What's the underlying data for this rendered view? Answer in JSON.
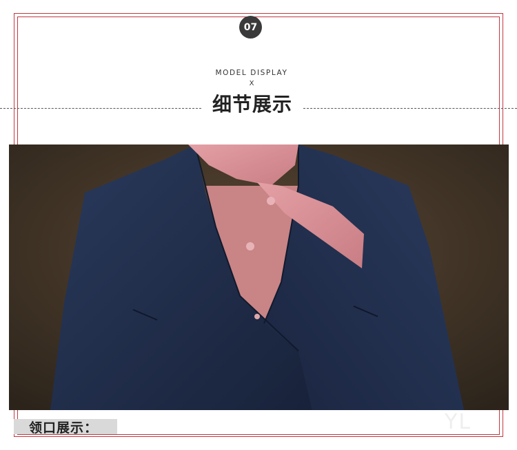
{
  "badge": {
    "number": "07"
  },
  "header": {
    "subtitle": "MODEL DISPLAY",
    "separator": "X",
    "title": "细节展示"
  },
  "photo": {
    "subject": "navy blazer with pink shirt and pink neck scarf",
    "colors": {
      "jacket": "#1f2b45",
      "scarf": "#d99097",
      "shirt": "#c98486",
      "background": "#3d3226"
    }
  },
  "caption": {
    "text": "领口展示："
  },
  "watermark": {
    "text": "YL"
  },
  "colors": {
    "frame": "#c2373f",
    "badge": "#3a3a3a",
    "caption_bar": "#d9d9d9"
  }
}
